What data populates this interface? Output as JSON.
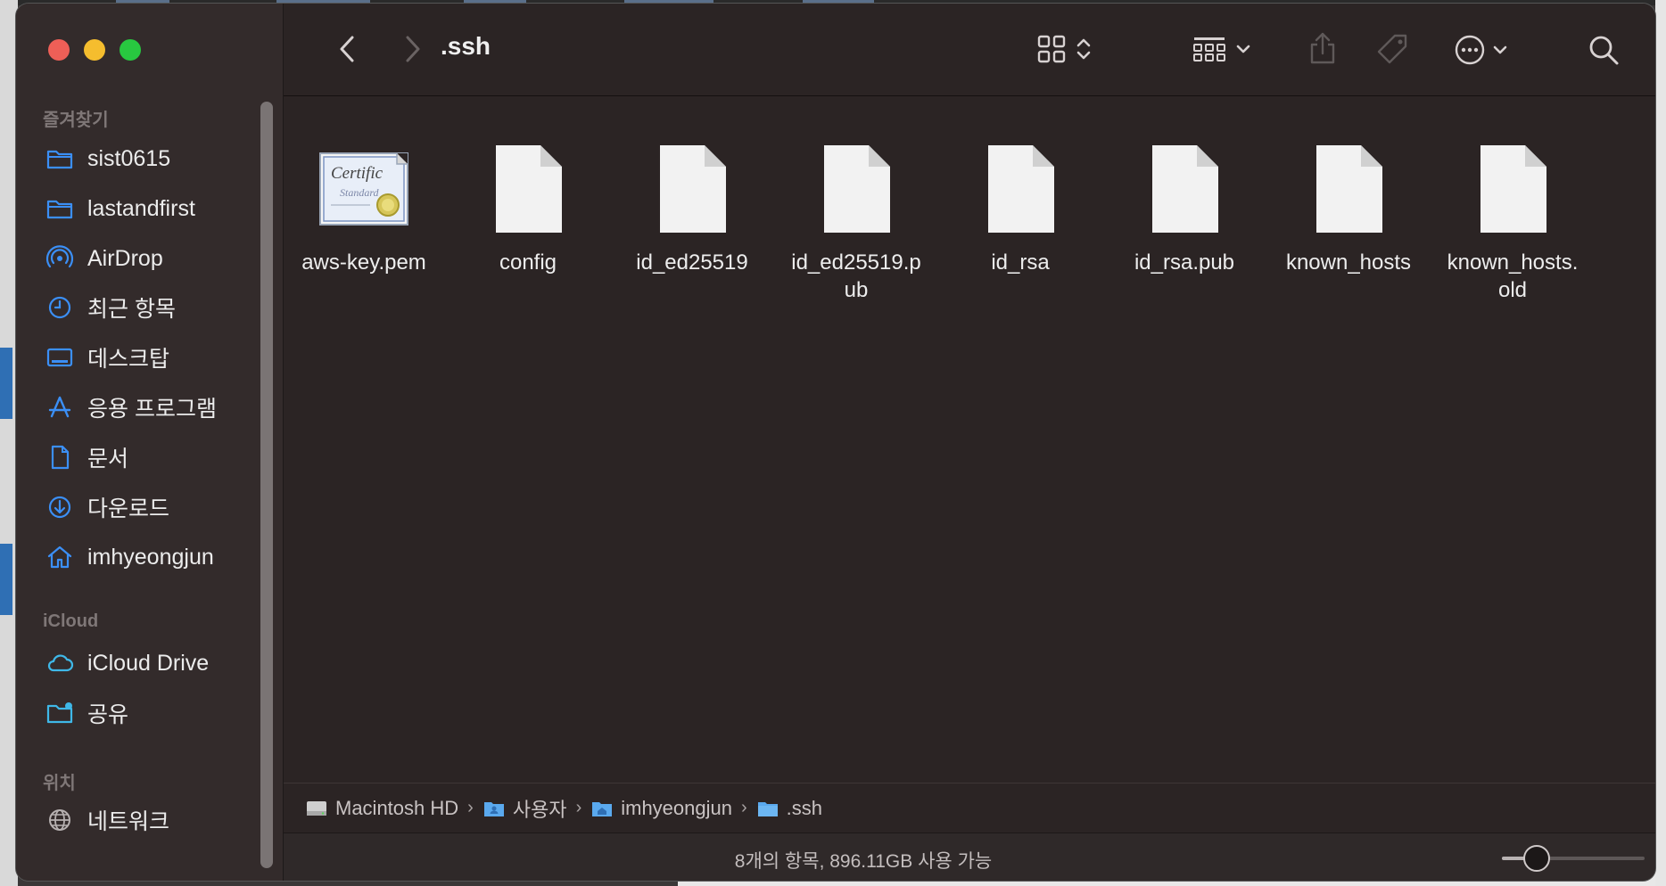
{
  "window": {
    "title": ".ssh"
  },
  "sidebar": {
    "favorites_label": "즐겨찾기",
    "favorites": [
      {
        "label": "sist0615",
        "icon": "folder-icon"
      },
      {
        "label": "lastandfirst",
        "icon": "folder-icon"
      },
      {
        "label": "AirDrop",
        "icon": "airdrop-icon"
      },
      {
        "label": "최근 항목",
        "icon": "clock-icon"
      },
      {
        "label": "데스크탑",
        "icon": "desktop-icon"
      },
      {
        "label": "응용 프로그램",
        "icon": "applications-icon"
      },
      {
        "label": "문서",
        "icon": "document-icon"
      },
      {
        "label": "다운로드",
        "icon": "download-icon"
      },
      {
        "label": "imhyeongjun",
        "icon": "home-icon"
      }
    ],
    "icloud_label": "iCloud",
    "icloud": [
      {
        "label": "iCloud Drive",
        "icon": "cloud-icon"
      },
      {
        "label": "공유",
        "icon": "shared-folder-icon"
      }
    ],
    "locations_label": "위치",
    "locations": [
      {
        "label": "네트워크",
        "icon": "globe-icon"
      }
    ]
  },
  "files": [
    {
      "name": "aws-key.pem",
      "line2": "",
      "kind": "certificate"
    },
    {
      "name": "config",
      "line2": "",
      "kind": "document"
    },
    {
      "name": "id_ed25519",
      "line2": "",
      "kind": "document"
    },
    {
      "name": "id_ed25519.p",
      "line2": "ub",
      "kind": "document"
    },
    {
      "name": "id_rsa",
      "line2": "",
      "kind": "document"
    },
    {
      "name": "id_rsa.pub",
      "line2": "",
      "kind": "document"
    },
    {
      "name": "known_hosts",
      "line2": "",
      "kind": "document"
    },
    {
      "name": "known_hosts.",
      "line2": "old",
      "kind": "document"
    }
  ],
  "pathbar": {
    "segments": [
      {
        "label": "Macintosh HD",
        "icon": "hard-drive-icon"
      },
      {
        "label": "사용자",
        "icon": "users-folder-icon"
      },
      {
        "label": "imhyeongjun",
        "icon": "home-folder-icon"
      },
      {
        "label": ".ssh",
        "icon": "folder-icon"
      }
    ],
    "separator": "›"
  },
  "status": {
    "text": "8개의 항목, 896.11GB 사용 가능",
    "icon_size_level": 0.15
  },
  "colors": {
    "accent": "#3b8ff6",
    "window_bg": "#2b2424",
    "sidebar_bg": "#332b2b"
  }
}
